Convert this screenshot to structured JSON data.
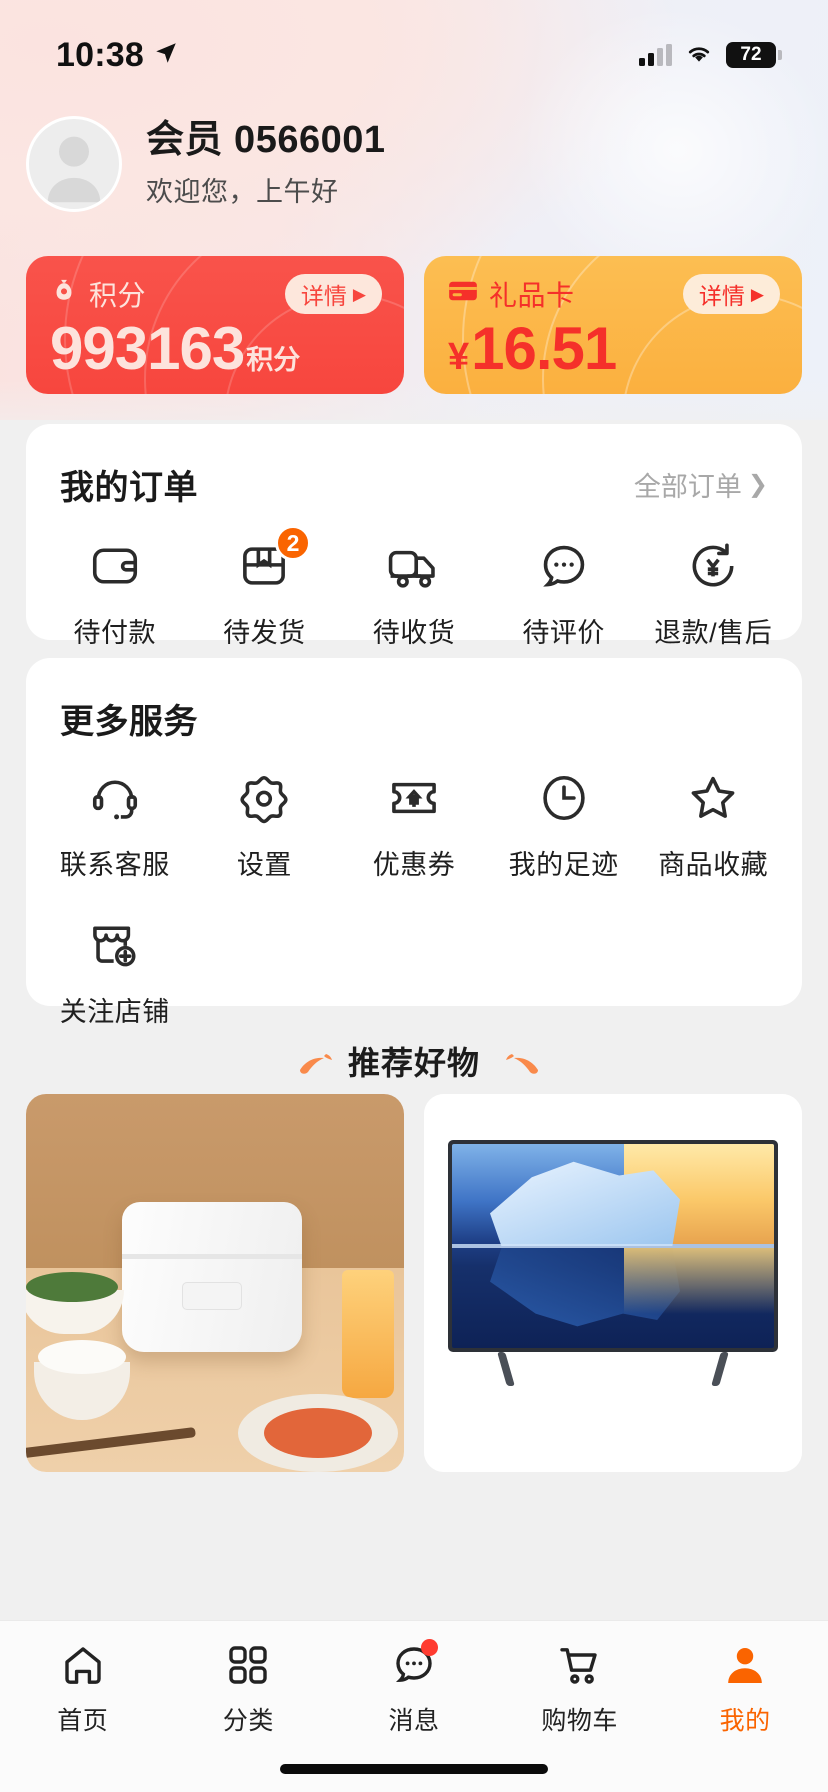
{
  "status_bar": {
    "time": "10:38",
    "location_icon": "location-arrow-icon",
    "signal_icon": "cellular-signal-icon",
    "wifi_icon": "wifi-icon",
    "battery_level": "72"
  },
  "user": {
    "avatar_icon": "user-avatar-placeholder",
    "name": "会员 0566001",
    "greeting": "欢迎您，上午好"
  },
  "balance_cards": [
    {
      "id": "points",
      "icon": "money-bag-icon",
      "label": "积分",
      "detail_label": "详情",
      "value": "993163",
      "suffix": "积分",
      "currency": "",
      "bg_color": "#F7463E",
      "text_color": "#FDE3DC"
    },
    {
      "id": "gift-card",
      "icon": "credit-card-icon",
      "label": "礼品卡",
      "detail_label": "详情",
      "value": "16.51",
      "suffix": "",
      "currency": "¥",
      "bg_color": "#FBB03F",
      "text_color": "#F5302A"
    }
  ],
  "orders": {
    "title": "我的订单",
    "more_label": "全部订单",
    "items": [
      {
        "icon": "wallet-icon",
        "label": "待付款",
        "badge": ""
      },
      {
        "icon": "package-box-icon",
        "label": "待发货",
        "badge": "2"
      },
      {
        "icon": "delivery-truck-icon",
        "label": "待收货",
        "badge": ""
      },
      {
        "icon": "comment-bubble-icon",
        "label": "待评价",
        "badge": ""
      },
      {
        "icon": "refund-circle-icon",
        "label": "退款/售后",
        "badge": ""
      }
    ]
  },
  "services": {
    "title": "更多服务",
    "items": [
      {
        "icon": "headset-icon",
        "label": "联系客服"
      },
      {
        "icon": "gear-icon",
        "label": "设置"
      },
      {
        "icon": "coupon-ticket-icon",
        "label": "优惠券"
      },
      {
        "icon": "clock-icon",
        "label": "我的足迹"
      },
      {
        "icon": "star-icon",
        "label": "商品收藏"
      },
      {
        "icon": "shop-add-icon",
        "label": "关注店铺"
      }
    ]
  },
  "recommend": {
    "title": "推荐好物",
    "left_decoration_icon": "leaf-decoration-icon",
    "right_decoration_icon": "leaf-decoration-icon",
    "products": [
      {
        "image_alt": "rice-cooker-product-image"
      },
      {
        "image_alt": "television-product-image"
      }
    ]
  },
  "tabbar": {
    "items": [
      {
        "icon": "home-icon",
        "label": "首页",
        "active": false,
        "dot": false
      },
      {
        "icon": "grid-category-icon",
        "label": "分类",
        "active": false,
        "dot": false
      },
      {
        "icon": "message-bubble-icon",
        "label": "消息",
        "active": false,
        "dot": true
      },
      {
        "icon": "shopping-cart-icon",
        "label": "购物车",
        "active": false,
        "dot": false
      },
      {
        "icon": "person-icon",
        "label": "我的",
        "active": true,
        "dot": false
      }
    ],
    "active_color": "#FA6400"
  }
}
